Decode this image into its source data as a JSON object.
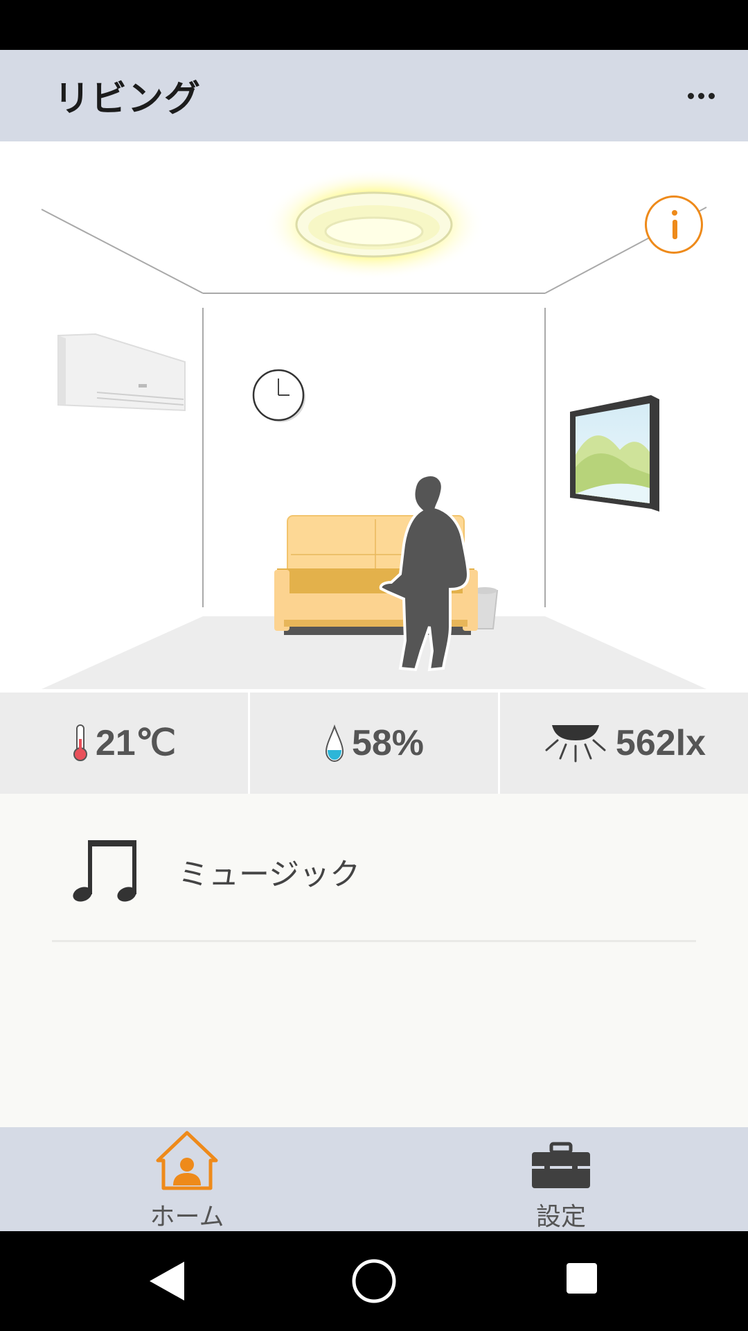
{
  "app_bar": {
    "title": "リビング",
    "more_icon": "more-horizontal-icon"
  },
  "room": {
    "info_icon": "info-icon",
    "accent_color": "#ee8a1a",
    "objects": [
      "ceiling-light",
      "air-conditioner",
      "wall-clock",
      "sofa",
      "person",
      "trash-can",
      "wall-picture"
    ]
  },
  "sensors": {
    "temperature": {
      "icon": "thermometer-icon",
      "value": "21℃"
    },
    "humidity": {
      "icon": "water-drop-icon",
      "value": "58%"
    },
    "illuminance": {
      "icon": "lamp-icon",
      "value": "562lx"
    }
  },
  "devices": [
    {
      "icon": "music-note-icon",
      "label": "ミュージック"
    }
  ],
  "bottom_nav": {
    "items": [
      {
        "icon": "home-icon",
        "label": "ホーム",
        "active": true,
        "color": "#ee8a1a"
      },
      {
        "icon": "toolbox-icon",
        "label": "設定",
        "active": false,
        "color": "#404040"
      }
    ]
  },
  "system_nav": [
    "back-icon",
    "home-circle-icon",
    "recents-icon"
  ]
}
